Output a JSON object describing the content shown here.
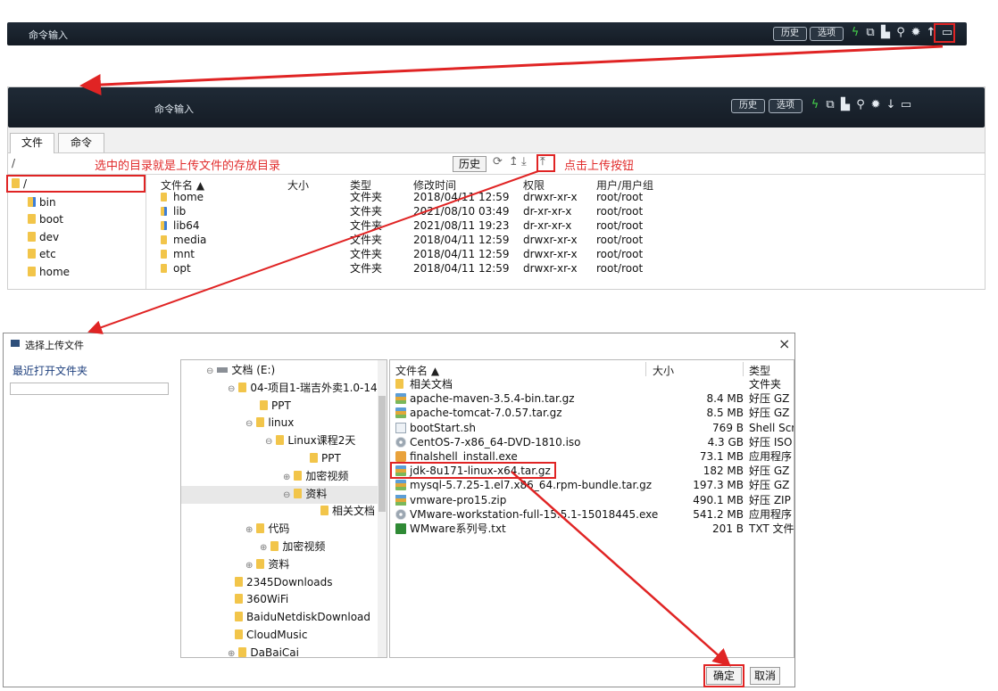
{
  "top_bar": {
    "label": "命令输入",
    "history": "历史",
    "options": "选项"
  },
  "panel": {
    "label": "命令输入",
    "history": "历史",
    "options": "选项",
    "tabs": [
      "文件",
      "命令"
    ],
    "path": "/",
    "annot_left": "选中的目录就是上传文件的存放目录",
    "annot_right": "点击上传按钮",
    "history_btn": "历史",
    "tree": [
      "/",
      "bin",
      "boot",
      "dev",
      "etc",
      "home"
    ],
    "columns": [
      "文件名 ▲",
      "大小",
      "类型",
      "修改时间",
      "权限",
      "用户/用户组"
    ],
    "rows": [
      {
        "name": "home",
        "size": "",
        "type": "文件夹",
        "mtime": "2018/04/11 12:59",
        "perm": "drwxr-xr-x",
        "owner": "root/root"
      },
      {
        "name": "lib",
        "size": "",
        "type": "文件夹",
        "mtime": "2021/08/10 03:49",
        "perm": "dr-xr-xr-x",
        "owner": "root/root"
      },
      {
        "name": "lib64",
        "size": "",
        "type": "文件夹",
        "mtime": "2021/08/11 19:23",
        "perm": "dr-xr-xr-x",
        "owner": "root/root"
      },
      {
        "name": "media",
        "size": "",
        "type": "文件夹",
        "mtime": "2018/04/11 12:59",
        "perm": "drwxr-xr-x",
        "owner": "root/root"
      },
      {
        "name": "mnt",
        "size": "",
        "type": "文件夹",
        "mtime": "2018/04/11 12:59",
        "perm": "drwxr-xr-x",
        "owner": "root/root"
      },
      {
        "name": "opt",
        "size": "",
        "type": "文件夹",
        "mtime": "2018/04/11 12:59",
        "perm": "drwxr-xr-x",
        "owner": "root/root"
      }
    ]
  },
  "dialog": {
    "title": "选择上传文件",
    "close": "×",
    "recent": "最近打开文件夹",
    "tree": [
      "文档 (E:)",
      "04-项目1-瑞吉外卖1.0-14",
      "PPT",
      "linux",
      "Linux课程2天",
      "PPT",
      "加密视频",
      "资料",
      "相关文档",
      "代码",
      "加密视频",
      "资料",
      "2345Downloads",
      "360WiFi",
      "BaiduNetdiskDownload",
      "CloudMusic",
      "DaBaiCai"
    ],
    "columns": [
      "文件名 ▲",
      "大小",
      "类型"
    ],
    "files": [
      {
        "name": "相关文档",
        "size": "",
        "type": "文件夹",
        "icon": "folder"
      },
      {
        "name": "apache-maven-3.5.4-bin.tar.gz",
        "size": "8.4 MB",
        "type": "好压 GZ .",
        "icon": "gz"
      },
      {
        "name": "apache-tomcat-7.0.57.tar.gz",
        "size": "8.5 MB",
        "type": "好压 GZ .",
        "icon": "gz"
      },
      {
        "name": "bootStart.sh",
        "size": "769 B",
        "type": "Shell Scri",
        "icon": "txt"
      },
      {
        "name": "CentOS-7-x86_64-DVD-1810.iso",
        "size": "4.3 GB",
        "type": "好压 ISO",
        "icon": "iso"
      },
      {
        "name": "finalshell_install.exe",
        "size": "73.1 MB",
        "type": "应用程序",
        "icon": "exe"
      },
      {
        "name": "jdk-8u171-linux-x64.tar.gz",
        "size": "182 MB",
        "type": "好压 GZ .",
        "icon": "gz"
      },
      {
        "name": "mysql-5.7.25-1.el7.x86_64.rpm-bundle.tar.gz",
        "size": "197.3 MB",
        "type": "好压 GZ .",
        "icon": "gz"
      },
      {
        "name": "vmware-pro15.zip",
        "size": "490.1 MB",
        "type": "好压 ZIP",
        "icon": "zip"
      },
      {
        "name": "VMware-workstation-full-15.5.1-15018445.exe",
        "size": "541.2 MB",
        "type": "应用程序",
        "icon": "iso"
      },
      {
        "name": "WMware系列号.txt",
        "size": "201 B",
        "type": "TXT 文件",
        "icon": "doc"
      }
    ],
    "ok": "确定",
    "cancel": "取消"
  },
  "colors": {
    "annotation": "#e02424",
    "green_icon": "#45d34a",
    "bar_bg": "#1a232e"
  }
}
